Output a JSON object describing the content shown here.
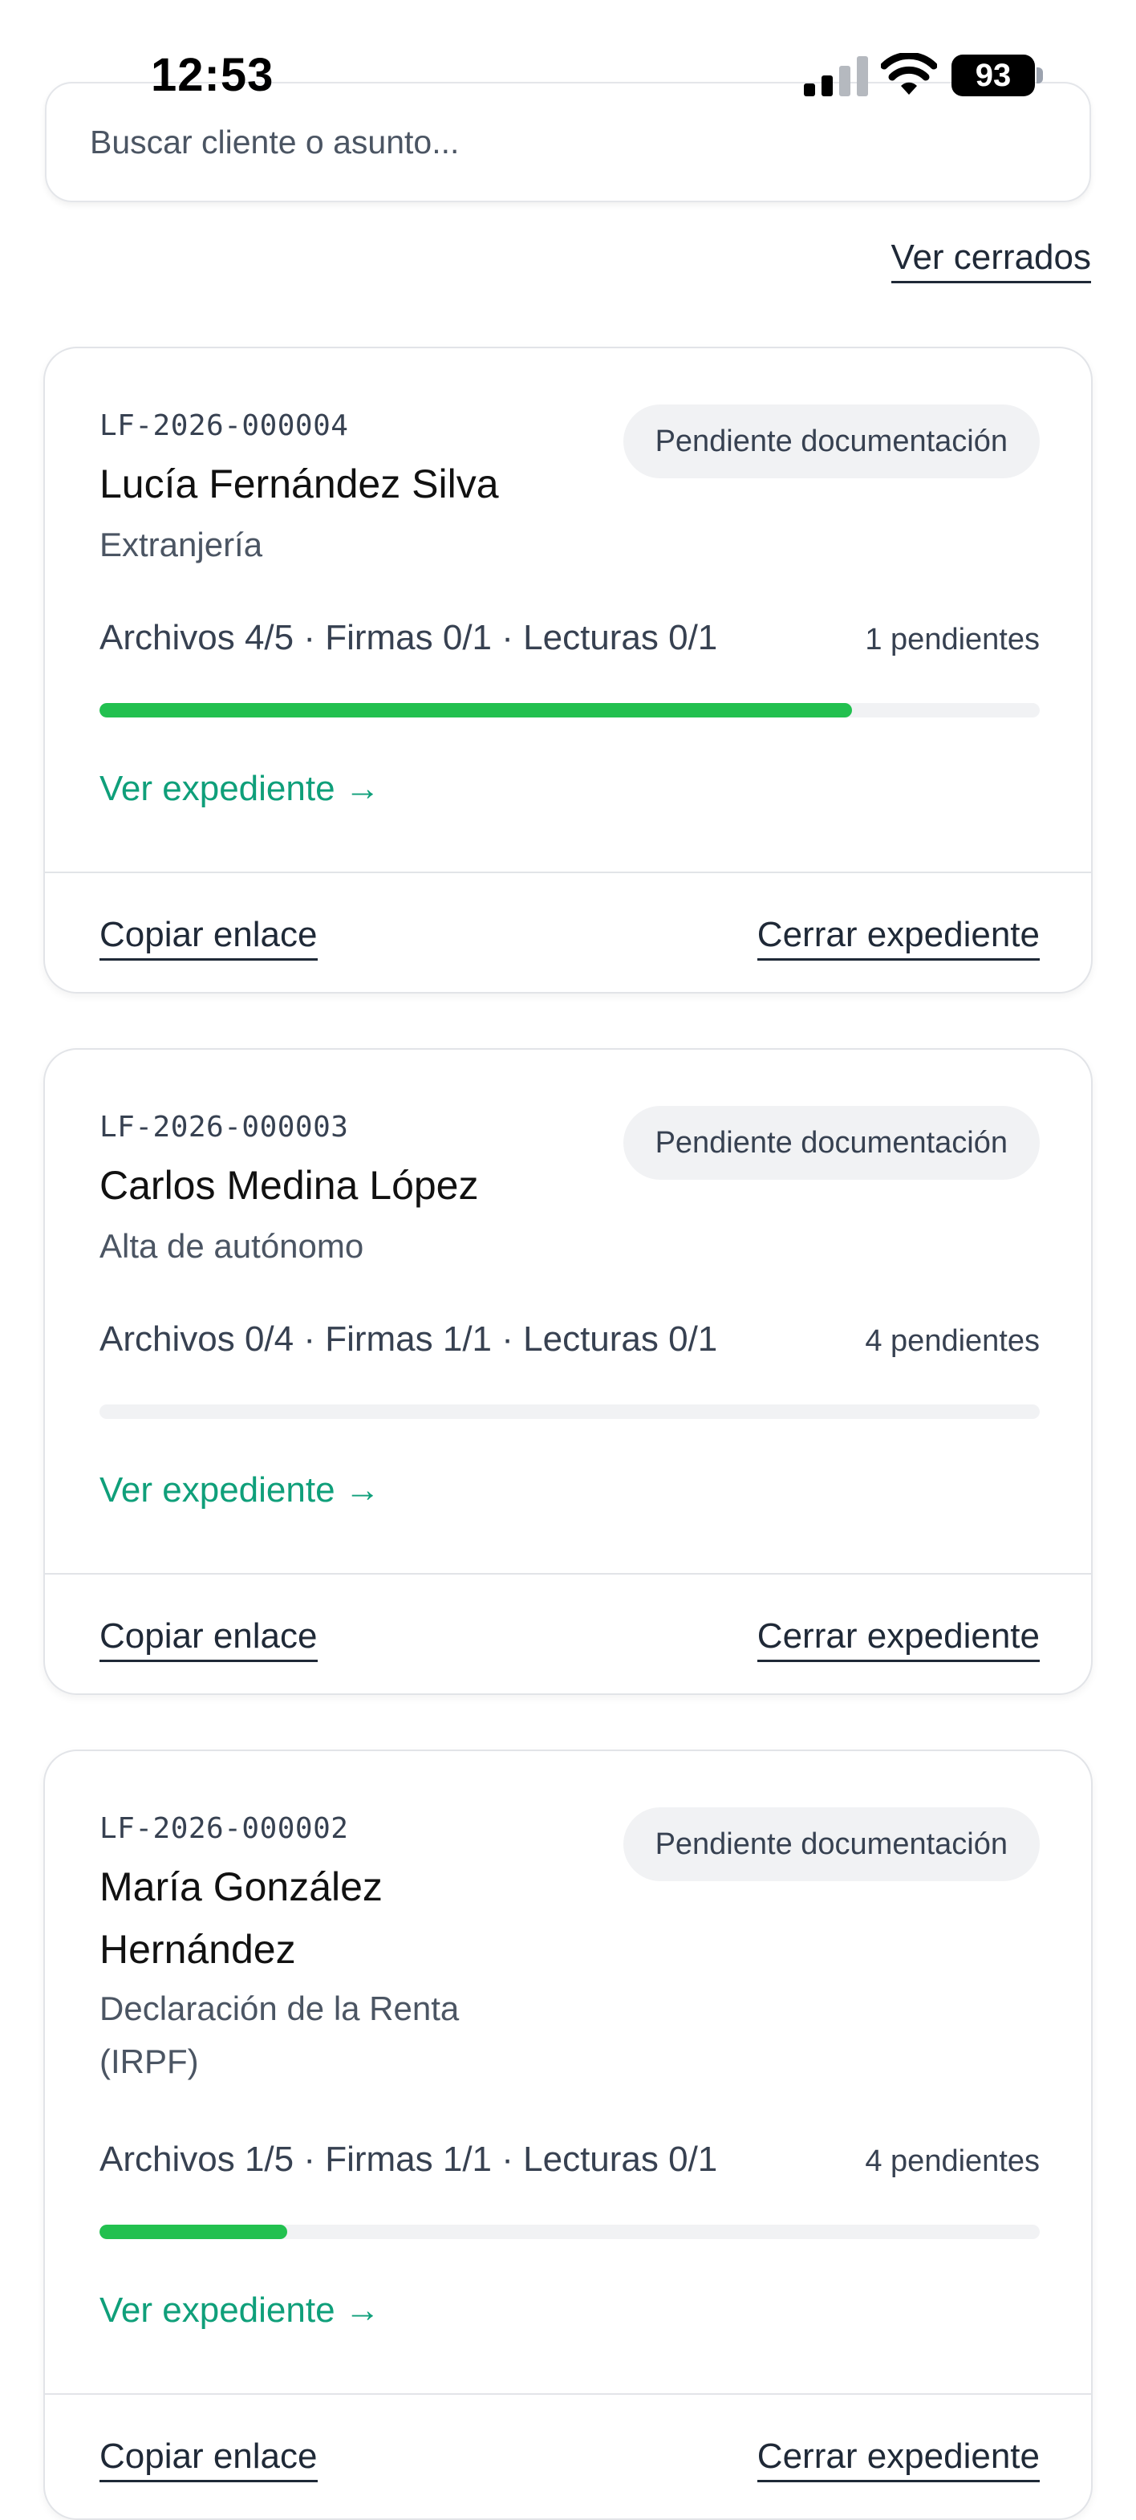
{
  "status_bar": {
    "time": "12:53",
    "battery": "93"
  },
  "search": {
    "placeholder": "Buscar cliente o asunto..."
  },
  "closed_link": "Ver cerrados",
  "cards": [
    {
      "ref": "LF-2026-000004",
      "name": "Lucía Fernández Silva",
      "matter": "Extranjería",
      "status": "Pendiente documentación",
      "stats": "Archivos 4/5 · Firmas 0/1 · Lecturas 0/1",
      "pending": "1 pendientes",
      "progress": 0.8,
      "view_label": "Ver expediente →",
      "copy_label": "Copiar enlace",
      "close_label": "Cerrar expediente"
    },
    {
      "ref": "LF-2026-000003",
      "name": "Carlos Medina López",
      "matter": "Alta de autónomo",
      "status": "Pendiente documentación",
      "stats": "Archivos 0/4 · Firmas 1/1 · Lecturas 0/1",
      "pending": "4 pendientes",
      "progress": 0,
      "view_label": "Ver expediente →",
      "copy_label": "Copiar enlace",
      "close_label": "Cerrar expediente"
    },
    {
      "ref": "LF-2026-000002",
      "name": "María González Hernández",
      "matter": "Declaración de la Renta (IRPF)",
      "status": "Pendiente documentación",
      "stats": "Archivos 1/5 · Firmas 1/1 · Lecturas 0/1",
      "pending": "4 pendientes",
      "progress": 0.2,
      "view_label": "Ver expediente →",
      "copy_label": "Copiar enlace",
      "close_label": "Cerrar expediente"
    }
  ]
}
